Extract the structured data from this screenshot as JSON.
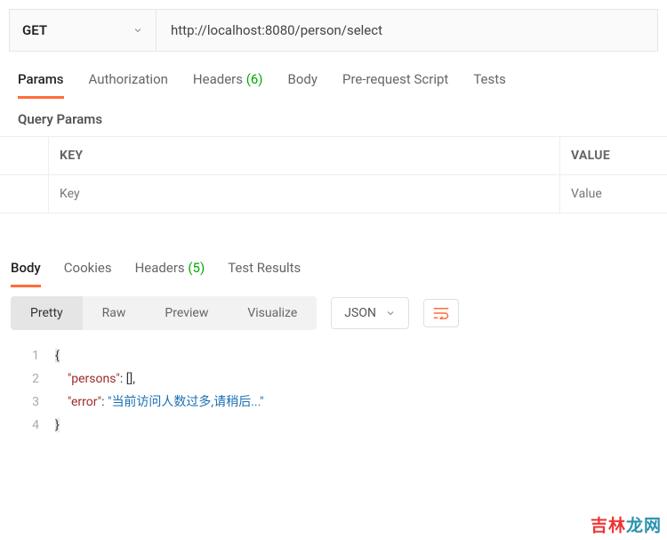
{
  "request": {
    "method": "GET",
    "url": "http://localhost:8080/person/select"
  },
  "tabs": {
    "params": "Params",
    "authorization": "Authorization",
    "headers_label": "Headers",
    "headers_count": "(6)",
    "body": "Body",
    "prerequest": "Pre-request Script",
    "tests": "Tests"
  },
  "query_params": {
    "title": "Query Params",
    "key_header": "KEY",
    "value_header": "VALUE",
    "key_placeholder": "Key",
    "value_placeholder": "Value"
  },
  "response_tabs": {
    "body": "Body",
    "cookies": "Cookies",
    "headers_label": "Headers",
    "headers_count": "(5)",
    "test_results": "Test Results"
  },
  "view_modes": {
    "pretty": "Pretty",
    "raw": "Raw",
    "preview": "Preview",
    "visualize": "Visualize"
  },
  "format": "JSON",
  "json_lines": {
    "l1": "{",
    "l2_key": "\"persons\"",
    "l2_rest": ": [],",
    "l3_key": "\"error\"",
    "l3_mid": ": ",
    "l3_val": "\"当前访问人数过多,请稍后...\"",
    "l4": "}"
  },
  "line_numbers": {
    "n1": "1",
    "n2": "2",
    "n3": "3",
    "n4": "4"
  },
  "watermark": {
    "a": "吉林",
    "b": "龙网"
  }
}
